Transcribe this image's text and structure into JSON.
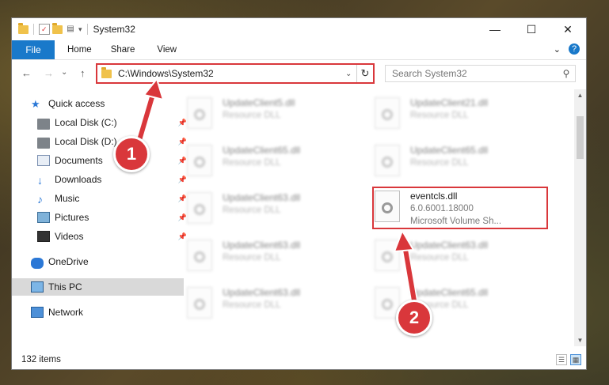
{
  "window": {
    "title": "System32",
    "controls": {
      "minimize": "—",
      "maximize": "☐",
      "close": "✕"
    }
  },
  "ribbon": {
    "tabs": [
      "File",
      "Home",
      "Share",
      "View"
    ],
    "expand": "⌄",
    "help": "?"
  },
  "address": {
    "path": "C:\\Windows\\System32",
    "search_placeholder": "Search System32",
    "nav": {
      "back": "←",
      "forward": "→",
      "recent": "⌄",
      "up": "↑"
    },
    "dropdown": "⌄",
    "refresh": "↻"
  },
  "sidebar": {
    "items": [
      {
        "label": "Quick access",
        "icon": "star-icon",
        "pinned": false
      },
      {
        "label": "Local Disk (C:)",
        "icon": "disk-icon",
        "pinned": true
      },
      {
        "label": "Local Disk (D:)",
        "icon": "disk-icon",
        "pinned": true
      },
      {
        "label": "Documents",
        "icon": "documents-icon",
        "pinned": true
      },
      {
        "label": "Downloads",
        "icon": "download-icon",
        "pinned": true
      },
      {
        "label": "Music",
        "icon": "music-icon",
        "pinned": true
      },
      {
        "label": "Pictures",
        "icon": "pictures-icon",
        "pinned": true
      },
      {
        "label": "Videos",
        "icon": "videos-icon",
        "pinned": true
      },
      {
        "label": "OneDrive",
        "icon": "onedrive-icon",
        "pinned": false
      },
      {
        "label": "This PC",
        "icon": "computer-icon",
        "pinned": false
      },
      {
        "label": "Network",
        "icon": "network-icon",
        "pinned": false
      }
    ],
    "pin_glyph": "📌"
  },
  "files": [
    {
      "name": "UpdateClient5.dll",
      "type": "Resource DLL"
    },
    {
      "name": "UpdateClient21.dll",
      "type": "Resource DLL"
    },
    {
      "name": "UpdateClient65.dll",
      "type": "Resource DLL"
    },
    {
      "name": "UpdateClient65.dll",
      "type": "Resource DLL"
    },
    {
      "name": "UpdateClient63.dll",
      "type": "Resource DLL"
    },
    {
      "name": "eventcls.dll",
      "version": "6.0.6001.18000",
      "description": "Microsoft Volume Sh..."
    },
    {
      "name": "UpdateClient63.dll",
      "type": "Resource DLL"
    },
    {
      "name": "UpdateClient63.dll",
      "type": "Resource DLL"
    },
    {
      "name": "UpdateClient63.dll",
      "type": "Resource DLL"
    },
    {
      "name": "UpdateClient65.dll",
      "type": "Resource DLL"
    }
  ],
  "status": {
    "item_count": "132 items"
  },
  "callouts": {
    "one": "1",
    "two": "2"
  },
  "colors": {
    "accent": "#1979ca",
    "highlight": "#d9373b"
  }
}
